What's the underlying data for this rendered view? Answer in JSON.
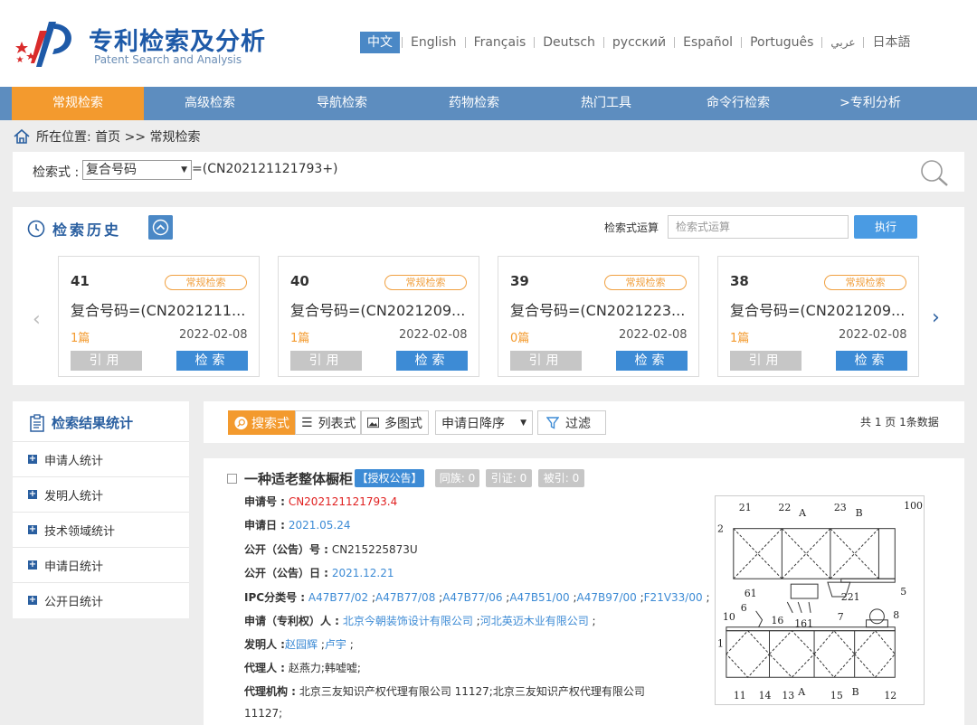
{
  "brand": {
    "title_cn": "专利检索及分析",
    "title_en": "Patent Search and Analysis"
  },
  "languages": [
    "中文",
    "English",
    "Français",
    "Deutsch",
    "русский",
    "Español",
    "Português",
    "عربي",
    "日本語"
  ],
  "nav": [
    "常规检索",
    "高级检索",
    "导航检索",
    "药物检索",
    "热门工具",
    "命令行检索",
    ">专利分析"
  ],
  "breadcrumb": "所在位置: 首页 >> 常规检索",
  "query": {
    "label": "检索式 :",
    "field": "复合号码",
    "expression": "=(CN202121121793+)"
  },
  "history": {
    "title": "检索历史",
    "calc_label": "检索式运算",
    "calc_placeholder": "检索式运算",
    "execute": "执行",
    "cards": [
      {
        "num": "41",
        "tag": "常规检索",
        "query": "复合号码=(CN2021211...",
        "count": "1篇",
        "date": "2022-02-08",
        "cite": "引用",
        "search": "检索"
      },
      {
        "num": "40",
        "tag": "常规检索",
        "query": "复合号码=(CN2021209...",
        "count": "1篇",
        "date": "2022-02-08",
        "cite": "引用",
        "search": "检索"
      },
      {
        "num": "39",
        "tag": "常规检索",
        "query": "复合号码=(CN2021223...",
        "count": "0篇",
        "date": "2022-02-08",
        "cite": "引用",
        "search": "检索"
      },
      {
        "num": "38",
        "tag": "常规检索",
        "query": "复合号码=(CN2021209...",
        "count": "1篇",
        "date": "2022-02-08",
        "cite": "引用",
        "search": "检索"
      }
    ]
  },
  "stats": {
    "title": "检索结果统计",
    "items": [
      "申请人统计",
      "发明人统计",
      "技术领域统计",
      "申请日统计",
      "公开日统计"
    ]
  },
  "toolbar": {
    "search_mode": "搜索式",
    "list_mode": "列表式",
    "multi_mode": "多图式",
    "sort": "申请日降序",
    "filter": "过滤",
    "count": "共 1 页 1条数据"
  },
  "result": {
    "title": "一种适老整体橱柜",
    "badge": "【授权公告】",
    "family": "同族: 0",
    "cite": "引证: 0",
    "cited": "被引: 0",
    "fields": {
      "app_no_label": "申请号 :",
      "app_no": "CN202121121793.4",
      "app_date_label": "申请日 :",
      "app_date": "2021.05.24",
      "pub_no_label": "公开（公告）号 :",
      "pub_no": "CN215225873U",
      "pub_date_label": "公开（公告）日 :",
      "pub_date": "2021.12.21",
      "ipc_label": "IPC分类号 :",
      "ipc": [
        "A47B77/02",
        "A47B77/08",
        "A47B77/06",
        "A47B51/00",
        "A47B97/00",
        "F21V33/00"
      ],
      "applicant_label": "申请（专利权）人 :",
      "applicants": [
        "北京今朝装饰设计有限公司",
        "河北英迈木业有限公司"
      ],
      "inventor_label": "发明人 :",
      "inventors": [
        "赵园辉",
        "卢宇"
      ],
      "agent_label": "代理人 :",
      "agent": "赵燕力;韩嘘嘘;",
      "agency_label": "代理机构 :",
      "agency_line1": "北京三友知识产权代理有限公司 11127;北京三友知识产权代理有限公司",
      "agency_line2": "11127;"
    },
    "drawing_labels": [
      "21",
      "22",
      "A",
      "23",
      "B",
      "100",
      "2",
      "5",
      "221",
      "61",
      "6",
      "10",
      "16",
      "161",
      "7",
      "8",
      "1",
      "11",
      "14",
      "13",
      "A",
      "15",
      "B",
      "12"
    ]
  }
}
